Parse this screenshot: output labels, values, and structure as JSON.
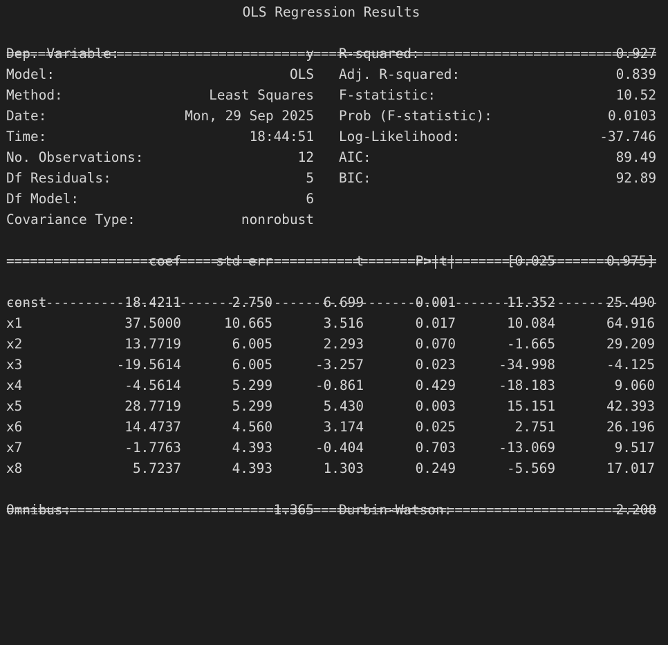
{
  "title": "OLS Regression Results",
  "rules": {
    "double": "=========================================================================================",
    "single": "-----------------------------------------------------------------------------------------"
  },
  "summary": [
    {
      "label": "Dep. Variable:",
      "value": "y",
      "label2": "R-squared:",
      "value2": "0.927"
    },
    {
      "label": "Model:",
      "value": "OLS",
      "label2": "Adj. R-squared:",
      "value2": "0.839"
    },
    {
      "label": "Method:",
      "value": "Least Squares",
      "label2": "F-statistic:",
      "value2": "10.52"
    },
    {
      "label": "Date:",
      "value": "Mon, 29 Sep 2025",
      "label2": "Prob (F-statistic):",
      "value2": "0.0103"
    },
    {
      "label": "Time:",
      "value": "18:44:51",
      "label2": "Log-Likelihood:",
      "value2": "-37.746"
    },
    {
      "label": "No. Observations:",
      "value": "12",
      "label2": "AIC:",
      "value2": "89.49"
    },
    {
      "label": "Df Residuals:",
      "value": "5",
      "label2": "BIC:",
      "value2": "92.89"
    },
    {
      "label": "Df Model:",
      "value": "6",
      "label2": "",
      "value2": ""
    },
    {
      "label": "Covariance Type:",
      "value": "nonrobust",
      "label2": "",
      "value2": ""
    }
  ],
  "coef_table": {
    "headers": [
      "coef",
      "std err",
      "t",
      "P>|t|",
      "[0.025",
      "0.975]"
    ],
    "rows": [
      {
        "name": "const",
        "coef": "18.4211",
        "std_err": "2.750",
        "t": "6.699",
        "p": "0.001",
        "lo": "11.352",
        "hi": "25.490"
      },
      {
        "name": "x1",
        "coef": "37.5000",
        "std_err": "10.665",
        "t": "3.516",
        "p": "0.017",
        "lo": "10.084",
        "hi": "64.916"
      },
      {
        "name": "x2",
        "coef": "13.7719",
        "std_err": "6.005",
        "t": "2.293",
        "p": "0.070",
        "lo": "-1.665",
        "hi": "29.209"
      },
      {
        "name": "x3",
        "coef": "-19.5614",
        "std_err": "6.005",
        "t": "-3.257",
        "p": "0.023",
        "lo": "-34.998",
        "hi": "-4.125"
      },
      {
        "name": "x4",
        "coef": "-4.5614",
        "std_err": "5.299",
        "t": "-0.861",
        "p": "0.429",
        "lo": "-18.183",
        "hi": "9.060"
      },
      {
        "name": "x5",
        "coef": "28.7719",
        "std_err": "5.299",
        "t": "5.430",
        "p": "0.003",
        "lo": "15.151",
        "hi": "42.393"
      },
      {
        "name": "x6",
        "coef": "14.4737",
        "std_err": "4.560",
        "t": "3.174",
        "p": "0.025",
        "lo": "2.751",
        "hi": "26.196"
      },
      {
        "name": "x7",
        "coef": "-1.7763",
        "std_err": "4.393",
        "t": "-0.404",
        "p": "0.703",
        "lo": "-13.069",
        "hi": "9.517"
      },
      {
        "name": "x8",
        "coef": "5.7237",
        "std_err": "4.393",
        "t": "1.303",
        "p": "0.249",
        "lo": "-5.569",
        "hi": "17.017"
      }
    ]
  },
  "diagnostics": [
    {
      "label": "Omnibus:",
      "value": "1.365",
      "label2": "Durbin-Watson:",
      "value2": "2.208"
    }
  ]
}
